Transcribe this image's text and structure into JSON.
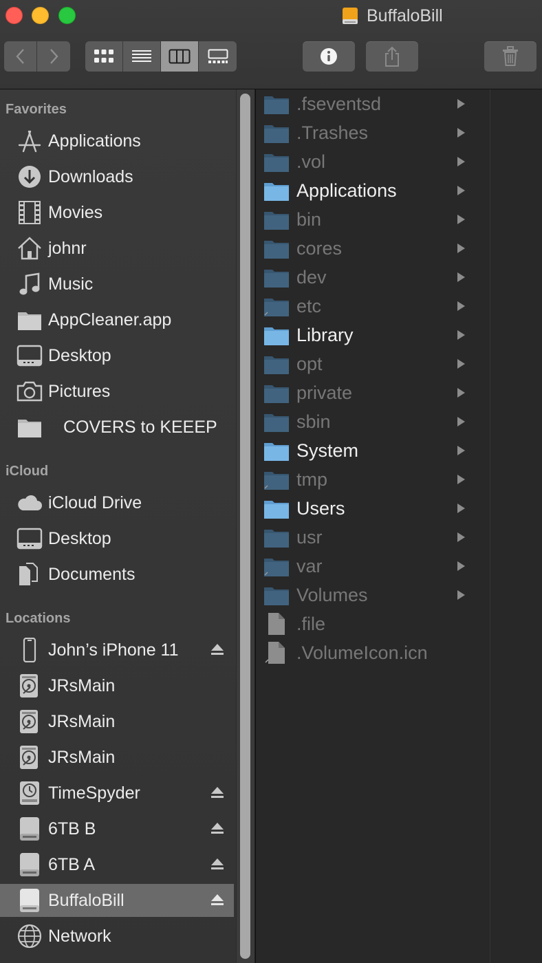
{
  "window": {
    "title": "BuffaloBill"
  },
  "toolbar": {
    "back_icon": "chevron-left-icon",
    "forward_icon": "chevron-right-icon",
    "view_modes": [
      "icon-view",
      "list-view",
      "column-view",
      "gallery-view"
    ],
    "active_view": "column-view",
    "info_icon": "info-icon",
    "share_icon": "share-icon",
    "trash_icon": "trash-icon"
  },
  "sidebar": {
    "sections": [
      {
        "title": "Favorites",
        "items": [
          {
            "label": "Applications",
            "icon": "applications-icon"
          },
          {
            "label": "Downloads",
            "icon": "downloads-icon"
          },
          {
            "label": "Movies",
            "icon": "movies-icon"
          },
          {
            "label": "johnr",
            "icon": "home-icon"
          },
          {
            "label": "Music",
            "icon": "music-icon"
          },
          {
            "label": "AppCleaner.app",
            "icon": "folder-icon"
          },
          {
            "label": "Desktop",
            "icon": "desktop-icon"
          },
          {
            "label": "Pictures",
            "icon": "camera-icon"
          },
          {
            "label": "COVERS to KEEEP",
            "icon": "folder-icon"
          }
        ]
      },
      {
        "title": "iCloud",
        "items": [
          {
            "label": "iCloud Drive",
            "icon": "cloud-icon"
          },
          {
            "label": "Desktop",
            "icon": "desktop-icon"
          },
          {
            "label": "Documents",
            "icon": "documents-icon"
          }
        ]
      },
      {
        "title": "Locations",
        "items": [
          {
            "label": "John’s iPhone 11",
            "icon": "iphone-icon",
            "eject": true
          },
          {
            "label": "JRsMain",
            "icon": "hard-disk-icon"
          },
          {
            "label": "JRsMain",
            "icon": "hard-disk-icon"
          },
          {
            "label": "JRsMain",
            "icon": "hard-disk-icon"
          },
          {
            "label": "TimeSpyder",
            "icon": "time-machine-icon",
            "eject": true
          },
          {
            "label": "6TB B",
            "icon": "external-drive-icon",
            "eject": true
          },
          {
            "label": "6TB A",
            "icon": "external-drive-icon",
            "eject": true
          },
          {
            "label": "BuffaloBill",
            "icon": "external-drive-icon",
            "eject": true,
            "selected": true
          },
          {
            "label": "Network",
            "icon": "network-icon"
          }
        ]
      }
    ]
  },
  "column": {
    "items": [
      {
        "name": ".fseventsd",
        "kind": "folder",
        "hidden": true
      },
      {
        "name": ".Trashes",
        "kind": "folder",
        "hidden": true
      },
      {
        "name": ".vol",
        "kind": "folder",
        "hidden": true
      },
      {
        "name": "Applications",
        "kind": "folder",
        "hidden": false
      },
      {
        "name": "bin",
        "kind": "folder",
        "hidden": true
      },
      {
        "name": "cores",
        "kind": "folder",
        "hidden": true
      },
      {
        "name": "dev",
        "kind": "folder",
        "hidden": true
      },
      {
        "name": "etc",
        "kind": "folder-alias",
        "hidden": true
      },
      {
        "name": "Library",
        "kind": "folder",
        "hidden": false
      },
      {
        "name": "opt",
        "kind": "folder",
        "hidden": true
      },
      {
        "name": "private",
        "kind": "folder",
        "hidden": true
      },
      {
        "name": "sbin",
        "kind": "folder",
        "hidden": true
      },
      {
        "name": "System",
        "kind": "folder",
        "hidden": false
      },
      {
        "name": "tmp",
        "kind": "folder-alias",
        "hidden": true
      },
      {
        "name": "Users",
        "kind": "folder",
        "hidden": false
      },
      {
        "name": "usr",
        "kind": "folder",
        "hidden": true
      },
      {
        "name": "var",
        "kind": "folder-alias",
        "hidden": true
      },
      {
        "name": "Volumes",
        "kind": "folder",
        "hidden": true
      },
      {
        "name": ".file",
        "kind": "file",
        "hidden": true
      },
      {
        "name": ".VolumeIcon.icn",
        "kind": "file-alias",
        "hidden": true
      }
    ]
  }
}
